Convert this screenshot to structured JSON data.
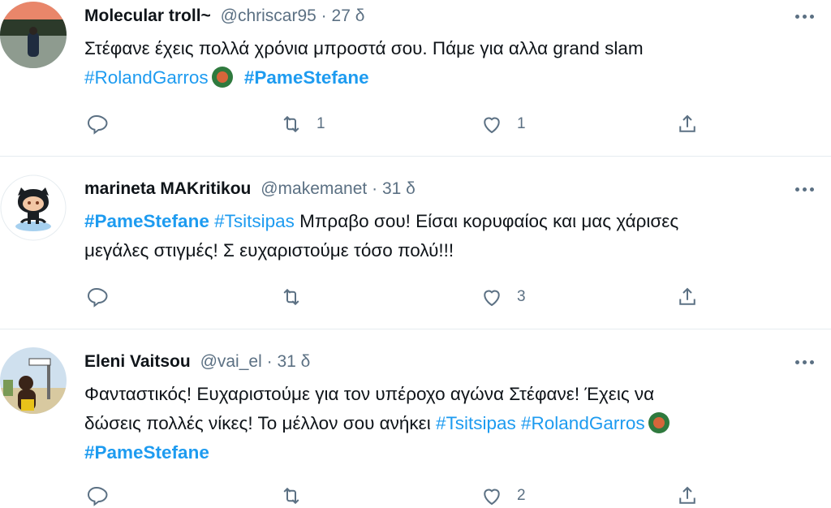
{
  "tweets": [
    {
      "name": "Molecular troll~",
      "handle": "@chriscar95",
      "dot": "·",
      "time": "27 δ",
      "text_plain": "Στέφανε έχεις πολλά χρόνια μπροστά σου. Πάμε για αλλα grand slam",
      "tag1": "#RolandGarros",
      "tag2": "#PameStefane",
      "replies": "",
      "retweets": "1",
      "likes": "1"
    },
    {
      "name": "marineta MAKritikou",
      "handle": "@makemanet",
      "dot": "·",
      "time": "31 δ",
      "tag1": "#PameStefane",
      "tag2": "#Tsitsipas",
      "text_plain": " Μπραβο σου! Είσαι κορυφαίος και μας χάρισες",
      "text_plain2": "μεγάλες στιγμές! Σ ευχαριστούμε τόσο πολύ!!!",
      "replies": "",
      "retweets": "",
      "likes": "3"
    },
    {
      "name": "Eleni Vaitsou",
      "handle": "@vai_el",
      "dot": "·",
      "time": "31 δ",
      "text_plain": "Φανταστικός! Ευχαριστούμε για τον υπέροχο αγώνα Στέφανε! Έχεις να",
      "text_plain2": "δώσεις πολλές νίκες! Το μέλλον σου ανήκει ",
      "tag1": "#Tsitsipas",
      "tag2": "#RolandGarros",
      "tag3": "#PameStefane",
      "replies": "",
      "retweets": "",
      "likes": "2"
    }
  ],
  "icons": {
    "reply": "reply-icon",
    "retweet": "retweet-icon",
    "like": "heart-icon",
    "share": "share-icon",
    "more": "more-icon",
    "emoji": "roland-garros-emoji"
  },
  "colors": {
    "hashtag": "#1d9bf0",
    "muted": "#5b7083",
    "divider": "#e6ecf0"
  }
}
